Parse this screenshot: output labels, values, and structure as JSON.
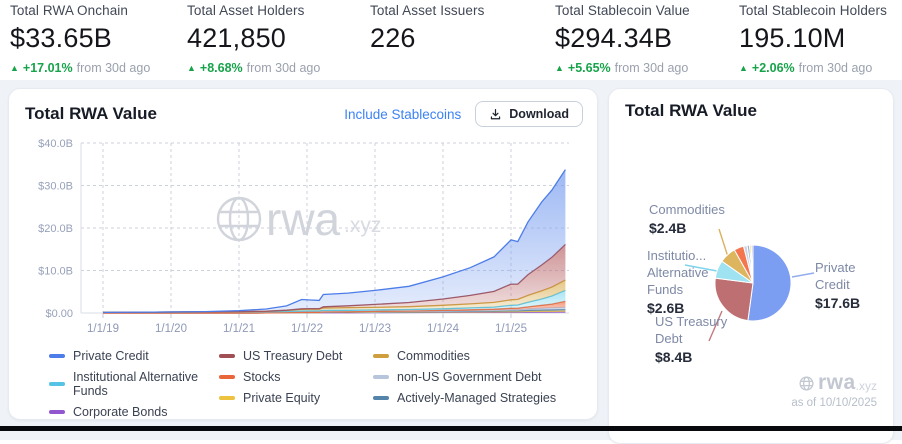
{
  "stats": [
    {
      "label": "Total RWA Onchain",
      "value": "$33.65B",
      "arrow": "▲",
      "delta": "+17.01%",
      "delta_suffix": "from 30d ago"
    },
    {
      "label": "Total Asset Holders",
      "value": "421,850",
      "arrow": "▲",
      "delta": "+8.68%",
      "delta_suffix": "from 30d ago"
    },
    {
      "label": "Total Asset Issuers",
      "value": "226"
    },
    {
      "label": "Total Stablecoin Value",
      "value": "$294.34B",
      "arrow": "▲",
      "delta": "+5.65%",
      "delta_suffix": "from 30d ago"
    },
    {
      "label": "Total Stablecoin Holders",
      "value": "195.10M",
      "arrow": "▲",
      "delta": "+2.06%",
      "delta_suffix": "from 30d ago"
    }
  ],
  "left_card": {
    "title": "Total RWA Value",
    "include_stablecoins_label": "Include Stablecoins",
    "download_label": "Download"
  },
  "right_card": {
    "title": "Total RWA Value",
    "as_of": "as of 10/10/2025",
    "labels": {
      "commodities": {
        "line1": "Commodities",
        "value": "$2.4B"
      },
      "inst_alt": {
        "line1": "Institutio...",
        "line2": "Alternative",
        "line3": "Funds",
        "value": "$2.6B"
      },
      "us_treasury": {
        "line1": "US Treasury",
        "line2": "Debt",
        "value": "$8.4B"
      },
      "private_credit": {
        "line1": "Private Credit",
        "value": "$17.6B"
      }
    }
  },
  "watermark": {
    "name": "rwa",
    "tld": ".xyz"
  },
  "colors": {
    "accent_blue": "#3c82f6",
    "positive_green": "#17a34a",
    "page_bg": "#eff2f7"
  },
  "chart_data": [
    {
      "type": "area",
      "stacked": true,
      "title": "Total RWA Value",
      "unit": "USD billions",
      "ylim": [
        0,
        40
      ],
      "y_grid": [
        0,
        10,
        20,
        30,
        40
      ],
      "y_tick_labels": [
        "$0.00",
        "$10.0B",
        "$20.0B",
        "$30.0B",
        "$40.0B"
      ],
      "x_tick_years": [
        2019,
        2020,
        2021,
        2022,
        2023,
        2024,
        2025
      ],
      "x_tick_labels": [
        "1/1/19",
        "1/1/20",
        "1/1/21",
        "1/1/22",
        "1/1/23",
        "1/1/24",
        "1/1/25"
      ],
      "x_years": [
        2019,
        2019.75,
        2020.5,
        2021,
        2021.4,
        2021.7,
        2021.92,
        2022.05,
        2022.18,
        2022.24,
        2022.6,
        2023,
        2023.5,
        2024,
        2024.4,
        2024.75,
        2025,
        2025.1,
        2025.25,
        2025.45,
        2025.6,
        2025.8
      ],
      "series": [
        {
          "name": "Corporate Bonds",
          "color": "#9257cf",
          "fill": "#a86fd8",
          "values": [
            0,
            0,
            0,
            0.01,
            0.02,
            0.04,
            0.06,
            0.06,
            0.06,
            0.08,
            0.08,
            0.1,
            0.12,
            0.13,
            0.15,
            0.16,
            0.18,
            0.18,
            0.2,
            0.22,
            0.24,
            0.25
          ]
        },
        {
          "name": "Private Equity",
          "color": "#edc23f",
          "fill": "#f5d55e",
          "values": [
            0,
            0,
            0,
            0,
            0.01,
            0.02,
            0.04,
            0.04,
            0.04,
            0.05,
            0.06,
            0.07,
            0.08,
            0.1,
            0.12,
            0.14,
            0.16,
            0.16,
            0.18,
            0.2,
            0.22,
            0.25
          ]
        },
        {
          "name": "Actively-Managed Strategies",
          "color": "#5584ab",
          "fill": "#7aa3c4",
          "values": [
            0,
            0,
            0,
            0,
            0,
            0,
            0.02,
            0.02,
            0.02,
            0.04,
            0.05,
            0.06,
            0.08,
            0.1,
            0.13,
            0.16,
            0.2,
            0.2,
            0.25,
            0.3,
            0.32,
            0.35
          ]
        },
        {
          "name": "non-US Government Debt",
          "color": "#b6c4dc",
          "fill": "#ccd6e8",
          "values": [
            0,
            0,
            0,
            0,
            0,
            0,
            0.02,
            0.02,
            0.02,
            0.05,
            0.06,
            0.08,
            0.1,
            0.12,
            0.15,
            0.18,
            0.22,
            0.22,
            0.3,
            0.38,
            0.42,
            0.5
          ]
        },
        {
          "name": "Stocks",
          "color": "#e8663a",
          "fill": "#f0764c",
          "values": [
            0,
            0,
            0,
            0,
            0,
            0,
            0.02,
            0.02,
            0.02,
            0.03,
            0.04,
            0.06,
            0.1,
            0.15,
            0.2,
            0.25,
            0.35,
            0.38,
            0.5,
            0.7,
            0.9,
            1.4
          ]
        },
        {
          "name": "Institutional Alternative Funds",
          "color": "#54c3e6",
          "fill": "#8fdcf0",
          "values": [
            0.15,
            0.2,
            0.27,
            0.28,
            0.28,
            0.3,
            0.32,
            0.33,
            0.33,
            0.35,
            0.35,
            0.35,
            0.35,
            0.4,
            0.45,
            0.5,
            0.7,
            0.75,
            1.1,
            1.5,
            1.9,
            2.6
          ]
        },
        {
          "name": "Commodities",
          "color": "#cf9f3e",
          "fill": "#ddb55f",
          "values": [
            0,
            0,
            0.02,
            0.05,
            0.1,
            0.25,
            0.4,
            0.4,
            0.4,
            0.55,
            0.6,
            0.6,
            0.65,
            0.8,
            0.95,
            1.1,
            1.3,
            1.3,
            1.6,
            1.9,
            2.1,
            2.4
          ]
        },
        {
          "name": "US Treasury Debt",
          "color": "#a14f55",
          "fill": "#bd6f72",
          "values": [
            0,
            0,
            0,
            0,
            0.02,
            0.05,
            0.1,
            0.12,
            0.12,
            0.3,
            0.45,
            0.7,
            1,
            1.5,
            2,
            2.6,
            3.7,
            3.6,
            4.9,
            6.1,
            7,
            8.4
          ]
        },
        {
          "name": "Private Credit",
          "color": "#4d7de8",
          "fill": "#7da1f0",
          "values": [
            0,
            0.02,
            0.05,
            0.2,
            0.5,
            1,
            2.2,
            2.05,
            1.95,
            2.9,
            3,
            3.3,
            3.8,
            5.2,
            6.5,
            8.1,
            10.4,
            10,
            12.4,
            14.8,
            15.8,
            17.6
          ]
        }
      ]
    },
    {
      "type": "pie",
      "title": "Total RWA Value",
      "unit": "USD billions",
      "slices": [
        {
          "label": "Private Credit",
          "value": 17.6,
          "color": "#7b9ef3"
        },
        {
          "label": "US Treasury Debt",
          "value": 8.4,
          "color": "#bd6f72"
        },
        {
          "label": "Institutional Alternative Funds",
          "value": 2.6,
          "color": "#9fe2f2"
        },
        {
          "label": "Commodities",
          "value": 2.4,
          "color": "#ddb55f"
        },
        {
          "label": "Stocks",
          "value": 1.4,
          "color": "#f4764f"
        },
        {
          "label": "non-US Government Debt",
          "value": 0.5,
          "color": "#ccd5e4"
        },
        {
          "label": "Actively-Managed Strategies",
          "value": 0.35,
          "color": "#9fb6cf"
        },
        {
          "label": "Private Equity",
          "value": 0.25,
          "color": "#f2d269"
        },
        {
          "label": "Corporate Bonds",
          "value": 0.25,
          "color": "#c7b5e6"
        }
      ]
    }
  ]
}
